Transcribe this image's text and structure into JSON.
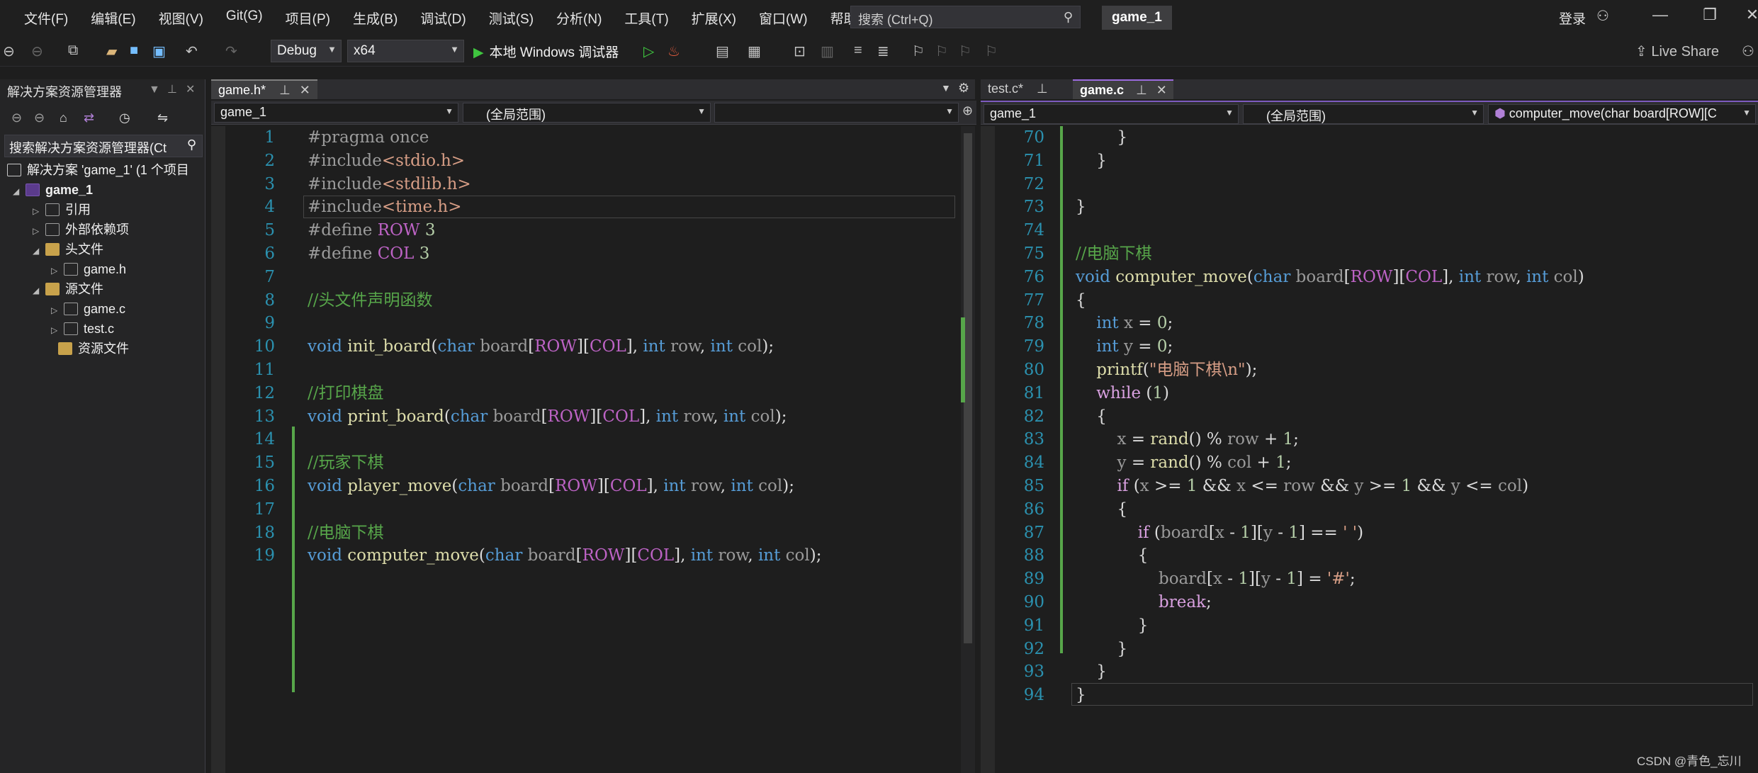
{
  "menubar": {
    "items": [
      "文件(F)",
      "编辑(E)",
      "视图(V)",
      "Git(G)",
      "项目(P)",
      "生成(B)",
      "调试(D)",
      "测试(S)",
      "分析(N)",
      "工具(T)",
      "扩展(X)",
      "窗口(W)",
      "帮助(H)"
    ],
    "search_placeholder": "搜索 (Ctrl+Q)",
    "solution_title": "game_1",
    "login": "登录"
  },
  "toolbar": {
    "config": "Debug",
    "platform": "x64",
    "run_label": "本地 Windows 调试器",
    "live_share": "Live Share"
  },
  "solution_explorer": {
    "title": "解决方案资源管理器",
    "search_placeholder": "搜索解决方案资源管理器(Ct",
    "items": [
      {
        "label": "解决方案 'game_1' (1 个项目"
      },
      {
        "label": "game_1"
      },
      {
        "label": "引用"
      },
      {
        "label": "外部依赖项"
      },
      {
        "label": "头文件"
      },
      {
        "label": "game.h"
      },
      {
        "label": "源文件"
      },
      {
        "label": "game.c"
      },
      {
        "label": "test.c"
      },
      {
        "label": "资源文件"
      }
    ]
  },
  "left_editor": {
    "tab": "game.h*",
    "nav_project": "game_1",
    "nav_scope": "(全局范围)",
    "lines": [
      {
        "n": "1",
        "code": "#pragma once"
      },
      {
        "n": "2",
        "code": "#include<stdio.h>"
      },
      {
        "n": "3",
        "code": "#include<stdlib.h>"
      },
      {
        "n": "4",
        "code": "#include<time.h>"
      },
      {
        "n": "5",
        "code": "#define ROW 3"
      },
      {
        "n": "6",
        "code": "#define COL 3"
      },
      {
        "n": "7",
        "code": ""
      },
      {
        "n": "8",
        "code": "//头文件声明函数"
      },
      {
        "n": "9",
        "code": ""
      },
      {
        "n": "10",
        "code": "void init_board(char board[ROW][COL], int row, int col);"
      },
      {
        "n": "11",
        "code": ""
      },
      {
        "n": "12",
        "code": "//打印棋盘"
      },
      {
        "n": "13",
        "code": "void print_board(char board[ROW][COL], int row, int col);"
      },
      {
        "n": "14",
        "code": ""
      },
      {
        "n": "15",
        "code": "//玩家下棋"
      },
      {
        "n": "16",
        "code": "void player_move(char board[ROW][COL], int row, int col);"
      },
      {
        "n": "17",
        "code": ""
      },
      {
        "n": "18",
        "code": "//电脑下棋"
      },
      {
        "n": "19",
        "code": "void computer_move(char board[ROW][COL], int row, int col);"
      }
    ]
  },
  "right_editor": {
    "tab_inactive": "test.c*",
    "tab_active": "game.c",
    "nav_project": "game_1",
    "nav_scope": "(全局范围)",
    "nav_function": "computer_move(char board[ROW][C",
    "lines": [
      {
        "n": "70",
        "code": "        }"
      },
      {
        "n": "71",
        "code": "    }"
      },
      {
        "n": "72",
        "code": ""
      },
      {
        "n": "73",
        "code": "}"
      },
      {
        "n": "74",
        "code": ""
      },
      {
        "n": "75",
        "code": "//电脑下棋"
      },
      {
        "n": "76",
        "code": "void computer_move(char board[ROW][COL], int row, int col)"
      },
      {
        "n": "77",
        "code": "{"
      },
      {
        "n": "78",
        "code": "    int x = 0;"
      },
      {
        "n": "79",
        "code": "    int y = 0;"
      },
      {
        "n": "80",
        "code": "    printf(\"电脑下棋\\n\");"
      },
      {
        "n": "81",
        "code": "    while (1)"
      },
      {
        "n": "82",
        "code": "    {"
      },
      {
        "n": "83",
        "code": "        x = rand() % row + 1;"
      },
      {
        "n": "84",
        "code": "        y = rand() % col + 1;"
      },
      {
        "n": "85",
        "code": "        if (x >= 1 && x <= row && y >= 1 && y <= col)"
      },
      {
        "n": "86",
        "code": "        {"
      },
      {
        "n": "87",
        "code": "            if (board[x - 1][y - 1] == ' ')"
      },
      {
        "n": "88",
        "code": "            {"
      },
      {
        "n": "89",
        "code": "                board[x - 1][y - 1] = '#';"
      },
      {
        "n": "90",
        "code": "                break;"
      },
      {
        "n": "91",
        "code": "            }"
      },
      {
        "n": "92",
        "code": "        }"
      },
      {
        "n": "93",
        "code": "    }"
      },
      {
        "n": "94",
        "code": "}"
      }
    ]
  },
  "watermark": "CSDN @青色_忘川"
}
